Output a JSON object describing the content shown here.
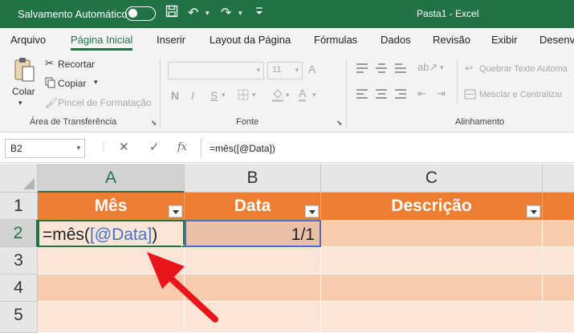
{
  "titlebar": {
    "autosave_label": "Salvamento Automático",
    "document_title": "Pasta1 - Excel"
  },
  "ribbon_tabs": [
    "Arquivo",
    "Página Inicial",
    "Inserir",
    "Layout da Página",
    "Fórmulas",
    "Dados",
    "Revisão",
    "Exibir",
    "Desenv"
  ],
  "clipboard": {
    "paste_label": "Colar",
    "cut_label": "Recortar",
    "copy_label": "Copiar",
    "format_painter_label": "Pincel de Formatação",
    "group_label": "Área de Transferência"
  },
  "font": {
    "size_value": "11",
    "bold": "N",
    "italic": "I",
    "underline": "S",
    "font_color_letter": "A",
    "grow_letter": "A",
    "group_label": "Fonte"
  },
  "alignment": {
    "wrap_text_label": "Quebrar Texto Automa",
    "merge_label": "Mesclar e Centralizar",
    "group_label": "Alinhamento"
  },
  "formula_bar": {
    "name_box": "B2",
    "cancel": "✕",
    "enter": "✓",
    "fx": "fx",
    "formula": "=mês([@Data])"
  },
  "grid": {
    "columns": [
      "A",
      "B",
      "C"
    ],
    "rows": [
      "1",
      "2",
      "3",
      "4",
      "5"
    ],
    "headers": [
      "Mês",
      "Data",
      "Descrição"
    ],
    "a2_prefix": "=mês(",
    "a2_ref": "[@Data]",
    "a2_suffix": ")",
    "b2_value": "1/1"
  },
  "colors": {
    "excel_green": "#217346",
    "table_header": "#ed7d31",
    "band_dark": "#f8cbad",
    "band_light": "#fce4d6",
    "reference_blue": "#4472c4",
    "arrow_red": "#e8161b"
  }
}
